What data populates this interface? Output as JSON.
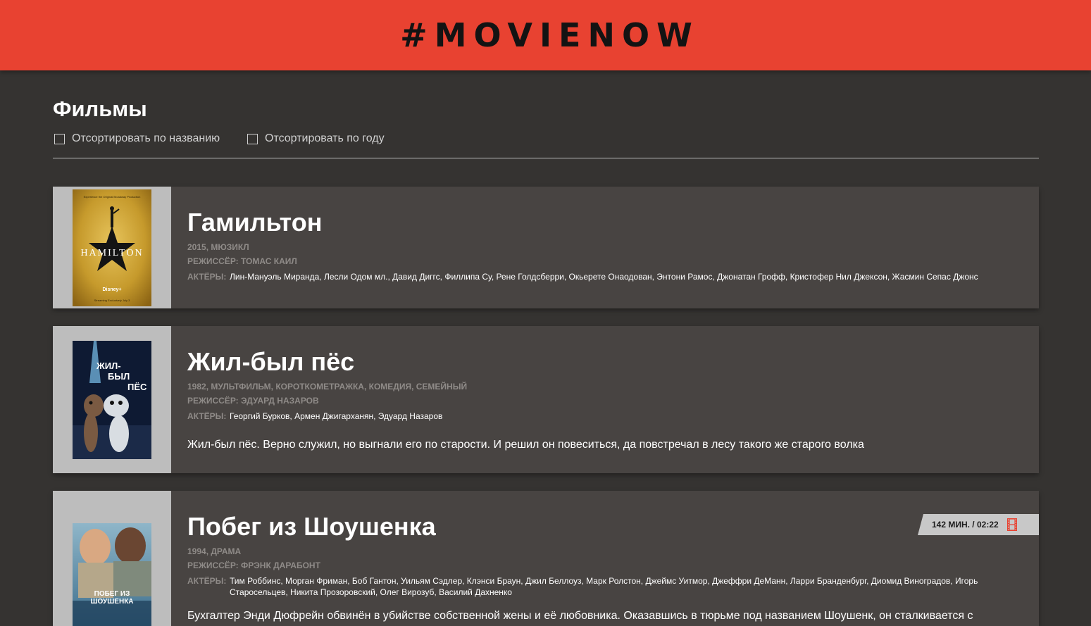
{
  "header": {
    "logo": "#MOVIENOW"
  },
  "page": {
    "title": "Фильмы",
    "sort_by_title": "Отсортировать по названию",
    "sort_by_year": "Отсортировать по году"
  },
  "movies": [
    {
      "title": "Гамильтон",
      "meta": "2015, мюзикл",
      "director": "Режиссёр: Томас Каил",
      "actors_label": "Актёры:",
      "actors": "Лин-Мануэль Миранда, Лесли Одом мл., Давид Диггс, Филлипа Су, Рене Голдсберри, Окьерете Онаодован, Энтони Рамос, Джонатан Грофф, Кристофер Нил Джексон, Жасмин Сепас Джонс",
      "poster_top_text": "Experience the Original Broadway Production",
      "poster_title": "HAMILTON",
      "poster_brand": "Disney+",
      "poster_bottom_text": "Streaming Exclusively July 3"
    },
    {
      "title": "Жил-был пёс",
      "meta": "1982, мультфильм, короткометражка, комедия, семейный",
      "director": "Режиссёр: Эдуард Назаров",
      "actors_label": "Актёры:",
      "actors": "Георгий Бурков, Армен Джигарханян, Эдуард Назаров",
      "description": "Жил-был пёс. Верно служил, но выгнали его по старости. И решил он повеситься, да повстречал в лесу такого же старого волка",
      "poster_title_1": "ЖИЛ-",
      "poster_title_2": "БЫЛ",
      "poster_title_3": "ПЁС"
    },
    {
      "title": "Побег из Шоушенка",
      "meta": "1994, драма",
      "director": "Режиссёр: Фрэнк Дарабонт",
      "actors_label": "Актёры:",
      "actors": "Тим Роббинс, Морган Фриман, Боб Гантон, Уильям Сэдлер, Клэнси Браун, Джил Беллоуз, Марк Ролстон, Джеймс Уитмор, Джеффри ДеМанн, Ларри Бранденбург, Диомид Виноградов, Игорь Старосельцев, Никита Прозоровский, Олег Вирозуб, Василий Дахненко",
      "description": "Бухгалтер Энди Дюфрейн обвинён в убийстве собственной жены и её любовника. Оказавшись в тюрьме под названием Шоушенк, он сталкивается с",
      "duration": "142 мин. / 02:22",
      "poster_title": "ПОБЕГ ИЗ ШОУШЕНКА"
    }
  ]
}
